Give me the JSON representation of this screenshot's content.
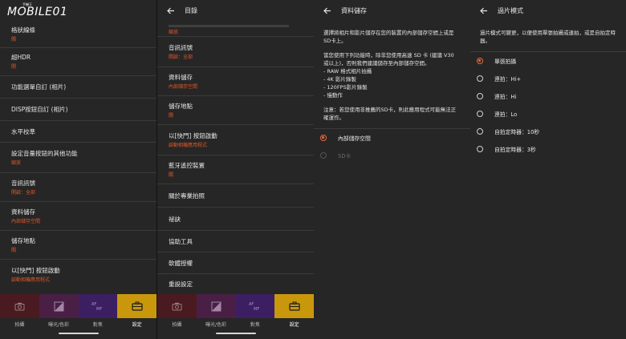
{
  "logo": {
    "text": "MOBILE01",
    "small": "手機王"
  },
  "panel1": {
    "items": [
      {
        "title": "格狀線條",
        "sub": "關"
      },
      {
        "title": "超HDR",
        "sub": "開"
      },
      {
        "title": "功能選單自訂 (相片)",
        "sub": ""
      },
      {
        "title": "DISP按鈕自訂 (相片)",
        "sub": ""
      },
      {
        "title": "水平校準",
        "sub": ""
      },
      {
        "title": "設定音量按鈕的其他功能",
        "sub": "縮放"
      },
      {
        "title": "音訊訊號",
        "sub": "開啟：全部"
      },
      {
        "title": "資料儲存",
        "sub": "內部儲存空間"
      },
      {
        "title": "儲存地點",
        "sub": "關"
      },
      {
        "title": "以[快門] 按鈕啟動",
        "sub": "啟動相機應用程式"
      }
    ]
  },
  "panel2": {
    "header": "目錄",
    "partial_sub": "縮放",
    "items": [
      {
        "title": "音訊訊號",
        "sub": "開啟：全部"
      },
      {
        "title": "資料儲存",
        "sub": "內部儲存空間"
      },
      {
        "title": "儲存地點",
        "sub": "關"
      },
      {
        "title": "以[快門] 按鈕啟動",
        "sub": "啟動相機應用程式"
      },
      {
        "title": "藍牙遙控裝置",
        "sub": "關"
      },
      {
        "title": "關於專業拍照",
        "sub": ""
      },
      {
        "title": "祕訣",
        "sub": ""
      },
      {
        "title": "協助工具",
        "sub": ""
      },
      {
        "title": "軟體授權",
        "sub": ""
      },
      {
        "title": "重設設定",
        "sub": ""
      }
    ]
  },
  "tabs": [
    {
      "label": "拍攝",
      "icon": "camera-icon",
      "color": "#4a1a21"
    },
    {
      "label": "曝光/色彩",
      "icon": "exposure-icon",
      "color": "#4a1f46"
    },
    {
      "label": "對焦",
      "icon": "af-mf-icon",
      "color": "#3c1f62"
    },
    {
      "label": "設定",
      "icon": "toolbox-icon",
      "color": "#c9970c"
    }
  ],
  "af_icon_text": {
    "top": "AF",
    "bottom": "MF"
  },
  "panel3": {
    "header": "資料儲存",
    "intro": "選擇將相片和影片儲存在您的裝置的內部儲存空間上或是SD卡上。",
    "list_intro": "當您使用下列功能時，除非您使用高速 SD 卡 (建議 V30 或以上)，否則我們建議儲存至內部儲存空間。",
    "bullets": [
      "- RAW 格式相片拍攝",
      "- 4K 影片錄製",
      "- 120FPS影片錄製",
      "- 慢動作"
    ],
    "note": "注意：若您使用非推薦的SD卡，則此應用程式可能無法正確運作。",
    "options": [
      {
        "label": "內部儲存空間",
        "selected": true,
        "disabled": false
      },
      {
        "label": "SD卡",
        "selected": false,
        "disabled": true
      }
    ]
  },
  "panel4": {
    "header": "過片模式",
    "intro": "過片模式可變更，以便使用單張拍攝或連拍，或是自拍定時器。",
    "options": [
      {
        "label": "單張拍攝",
        "selected": true
      },
      {
        "label": "連拍：Hi+",
        "selected": false
      },
      {
        "label": "連拍：Hi",
        "selected": false
      },
      {
        "label": "連拍：Lo",
        "selected": false
      },
      {
        "label": "自拍定時器：10秒",
        "selected": false
      },
      {
        "label": "自拍定時器：3秒",
        "selected": false
      }
    ]
  },
  "colors": {
    "accent": "#e0572a",
    "radio_on": "#f0683d",
    "panel_bg": "#262626"
  }
}
